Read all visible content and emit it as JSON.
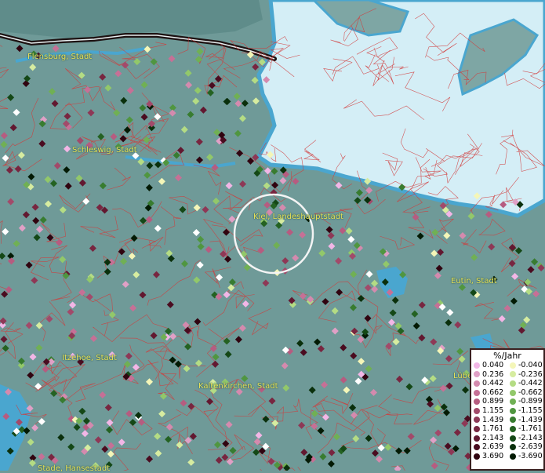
{
  "map": {
    "cities": [
      {
        "name": "Flensburg, Stadt"
      },
      {
        "name": "Schleswig, Stadt"
      },
      {
        "name": "Kiel, Landeshauptstadt"
      },
      {
        "name": "Eutin, Stadt"
      },
      {
        "name": "Itzehoe, Stadt"
      },
      {
        "name": "Kaltenkirchen, Stadt"
      },
      {
        "name": "Lübeck"
      },
      {
        "name": "Stade, Hansestadt"
      }
    ],
    "colors": {
      "water": "#d4eef6",
      "coast": "#4aa6cf",
      "land": "#6f9a98",
      "borders": "#d23a3a",
      "label": "#e8e25a"
    }
  },
  "legend": {
    "title": "%/Jahr",
    "positive": [
      {
        "value": "0.040",
        "color": "#f2b6e6"
      },
      {
        "value": "0.236",
        "color": "#e0a0c6"
      },
      {
        "value": "0.442",
        "color": "#d48aae"
      },
      {
        "value": "0.662",
        "color": "#c67096"
      },
      {
        "value": "0.899",
        "color": "#b65c80"
      },
      {
        "value": "1.155",
        "color": "#a24a6a"
      },
      {
        "value": "1.439",
        "color": "#8e3856"
      },
      {
        "value": "1.761",
        "color": "#782640"
      },
      {
        "value": "2.143",
        "color": "#621830"
      },
      {
        "value": "2.639",
        "color": "#4a0c20"
      },
      {
        "value": "3.690",
        "color": "#300410"
      }
    ],
    "negative": [
      {
        "value": "-0.040",
        "color": "#f4f6b8"
      },
      {
        "value": "-0.236",
        "color": "#d6eca0"
      },
      {
        "value": "-0.442",
        "color": "#b4dc84"
      },
      {
        "value": "-0.662",
        "color": "#92c86a"
      },
      {
        "value": "-0.899",
        "color": "#70b054"
      },
      {
        "value": "-1.155",
        "color": "#509640"
      },
      {
        "value": "-1.439",
        "color": "#387c30"
      },
      {
        "value": "-1.761",
        "color": "#246222"
      },
      {
        "value": "-2.143",
        "color": "#144816"
      },
      {
        "value": "-2.639",
        "color": "#0a300c"
      },
      {
        "value": "-3.690",
        "color": "#031a04"
      }
    ]
  }
}
